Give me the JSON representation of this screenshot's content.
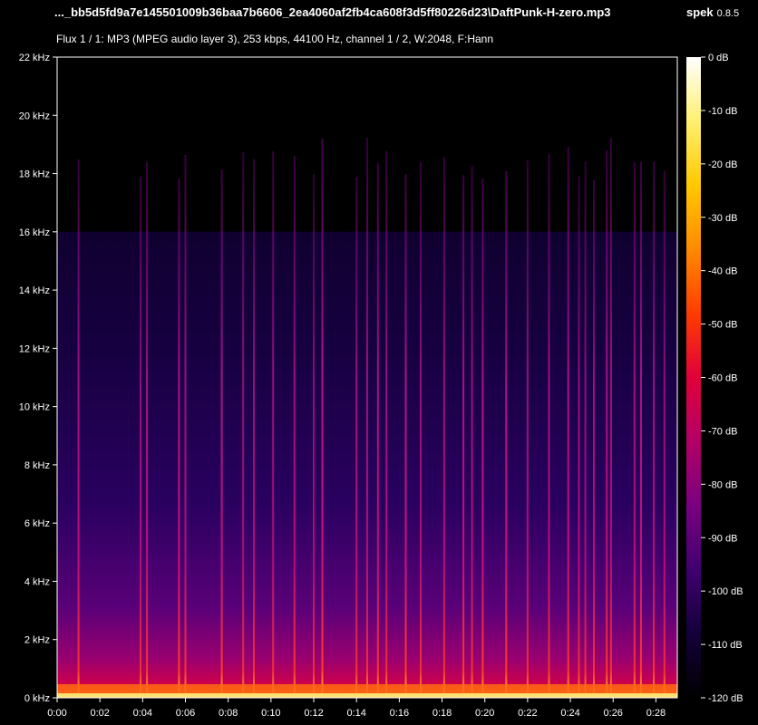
{
  "header": {
    "file_title": "..._bb5d5fd9a7e145501009b36baa7b6606_2ea4060af2fb4ca608f3d5ff80226d23\\DaftPunk-H-zero.mp3",
    "app_name": "spek",
    "app_version": "0.8.5",
    "stream_info": "Flux 1 / 1: MP3 (MPEG audio layer 3), 253 kbps, 44100 Hz, channel 1 / 2, W:2048, F:Hann"
  },
  "chart_data": {
    "type": "heatmap",
    "x_ticks": [
      "0:00",
      "0:02",
      "0:04",
      "0:06",
      "0:08",
      "0:10",
      "0:12",
      "0:14",
      "0:16",
      "0:18",
      "0:20",
      "0:22",
      "0:24",
      "0:26",
      "0:28"
    ],
    "x_tick_seconds": [
      0,
      2,
      4,
      6,
      8,
      10,
      12,
      14,
      16,
      18,
      20,
      22,
      24,
      26,
      28
    ],
    "x_max_seconds": 29,
    "y_ticks": [
      "0 kHz",
      "2 kHz",
      "4 kHz",
      "6 kHz",
      "8 kHz",
      "10 kHz",
      "12 kHz",
      "14 kHz",
      "16 kHz",
      "18 kHz",
      "20 kHz",
      "22 kHz"
    ],
    "y_tick_khz": [
      0,
      2,
      4,
      6,
      8,
      10,
      12,
      14,
      16,
      18,
      20,
      22
    ],
    "y_max_khz": 22,
    "colorbar_labels": [
      "0 dB",
      "-10 dB",
      "-20 dB",
      "-30 dB",
      "-40 dB",
      "-50 dB",
      "-60 dB",
      "-70 dB",
      "-80 dB",
      "-90 dB",
      "-100 dB",
      "-110 dB",
      "-120 dB"
    ],
    "colorbar_db": [
      0,
      -10,
      -20,
      -30,
      -40,
      -50,
      -60,
      -70,
      -80,
      -90,
      -100,
      -110,
      -120
    ],
    "colormap_colors": [
      "#ffffff",
      "#fff070",
      "#ffc800",
      "#ff8a00",
      "#ff3c00",
      "#e0003a",
      "#b20066",
      "#7a0080",
      "#400070",
      "#14003a",
      "#000000"
    ],
    "lowpass_cutoff_khz": 16,
    "transient_times_seconds": [
      1.0,
      3.9,
      4.2,
      5.7,
      6.0,
      7.7,
      8.7,
      9.2,
      10.1,
      11.1,
      12.0,
      12.4,
      14.0,
      14.5,
      15.0,
      15.4,
      16.3,
      17.0,
      18.1,
      19.0,
      19.4,
      19.9,
      21.0,
      22.0,
      23.0,
      23.9,
      24.4,
      24.7,
      25.1,
      25.7,
      25.9,
      27.0,
      27.3,
      27.9,
      28.4
    ],
    "grid": false
  }
}
